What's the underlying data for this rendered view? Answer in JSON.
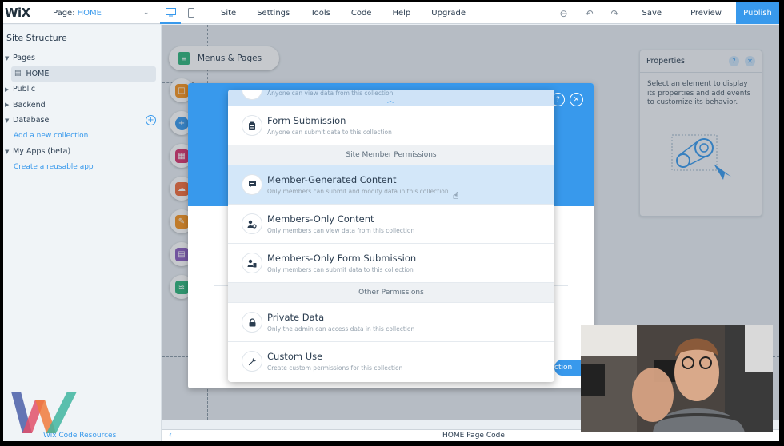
{
  "topbar": {
    "logo": "WiX",
    "page_label": "Page:",
    "page_value": "HOME",
    "menus": [
      "Site",
      "Settings",
      "Tools",
      "Code",
      "Help",
      "Upgrade"
    ],
    "save": "Save",
    "preview": "Preview",
    "publish": "Publish"
  },
  "site_structure": {
    "title": "Site Structure",
    "items": [
      {
        "label": "Pages"
      },
      {
        "label": "HOME"
      },
      {
        "label": "Public"
      },
      {
        "label": "Backend"
      },
      {
        "label": "Database"
      },
      {
        "label": "Add a new collection"
      },
      {
        "label": "My Apps (beta)"
      },
      {
        "label": "Create a reusable app"
      }
    ],
    "footer_link": "Wix Code Resources"
  },
  "canvas": {
    "menus_pages": "Menus & Pages"
  },
  "properties": {
    "title": "Properties",
    "description": "Select an element to display its properties and add events to customize its behavior."
  },
  "bottombar": {
    "code_label": "HOME Page Code"
  },
  "modal": {
    "create_button": "ction"
  },
  "permissions_dropdown": {
    "top_partial_desc": "Anyone can view data from this collection",
    "items_a": [
      {
        "title": "Form Submission",
        "desc": "Anyone can submit data to this collection",
        "icon": "form-icon"
      }
    ],
    "section_member": "Site Member Permissions",
    "items_b": [
      {
        "title": "Member-Generated Content",
        "desc": "Only members can submit and modify data in this collection",
        "icon": "chat-icon"
      },
      {
        "title": "Members-Only Content",
        "desc": "Only members can view data from this collection",
        "icon": "member-view-icon"
      },
      {
        "title": "Members-Only Form Submission",
        "desc": "Only members can submit data to this collection",
        "icon": "member-form-icon"
      }
    ],
    "section_other": "Other Permissions",
    "items_c": [
      {
        "title": "Private Data",
        "desc": "Only the admin can access data in this collection",
        "icon": "lock-icon"
      },
      {
        "title": "Custom Use",
        "desc": "Create custom permissions for this collection",
        "icon": "wrench-icon"
      }
    ]
  },
  "colors": {
    "accent": "#3899ec",
    "highlight": "#d3e7f9"
  }
}
